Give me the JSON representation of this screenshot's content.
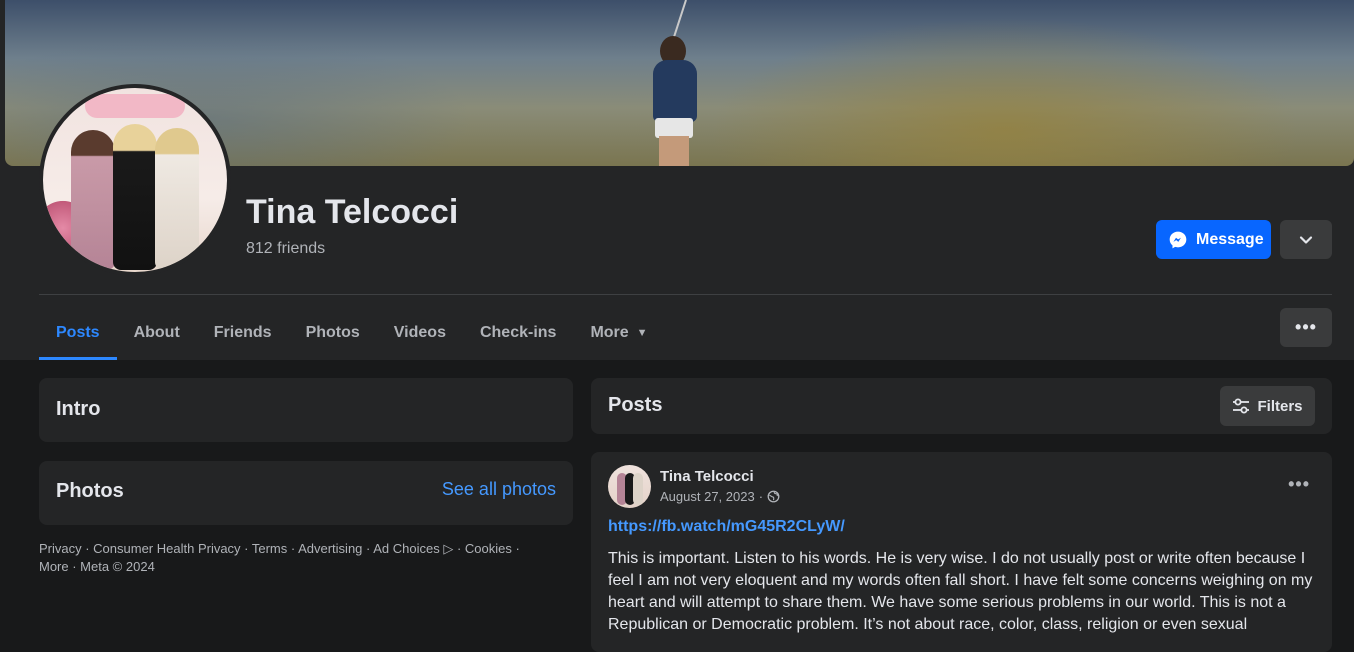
{
  "profile": {
    "name": "Tina Telcocci",
    "friends": "812 friends"
  },
  "actions": {
    "message_label": "Message"
  },
  "tabs": [
    {
      "label": "Posts"
    },
    {
      "label": "About"
    },
    {
      "label": "Friends"
    },
    {
      "label": "Photos"
    },
    {
      "label": "Videos"
    },
    {
      "label": "Check-ins"
    },
    {
      "label": "More"
    }
  ],
  "sidebar": {
    "intro_title": "Intro",
    "photos_title": "Photos",
    "see_all_photos": "See all photos",
    "footer_line1": "Privacy · Consumer Health Privacy · Terms · Advertising · Ad Choices ▷ · Cookies ·",
    "footer_line2": "More · Meta © 2024"
  },
  "posts": {
    "title": "Posts",
    "filters_label": "Filters",
    "items": [
      {
        "author": "Tina Telcocci",
        "date": "August 27, 2023",
        "link": "https://fb.watch/mG45R2CLyW/",
        "text": "This is important. Listen to his words. He is very wise. I do not usually post or write often because I feel I am not very eloquent and my words often fall short. I have felt some concerns weighing on my heart and will attempt to share them. We have some serious problems in our world. This is not a Republican or Democratic problem. It’s not about race, color, class, religion or even sexual"
      }
    ]
  },
  "colors": {
    "accent": "#2d88ff",
    "message_button": "#0866ff",
    "card_bg": "#242526",
    "page_bg": "#18191a"
  },
  "icons": {
    "message": "messenger-icon",
    "dropdown": "chevron-down-icon",
    "filters": "sliders-icon",
    "audience": "globe-icon"
  }
}
